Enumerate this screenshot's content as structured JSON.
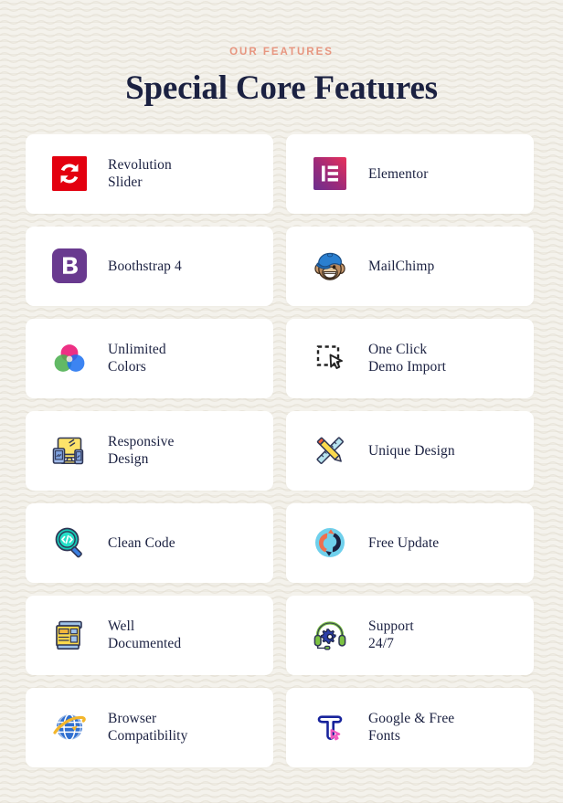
{
  "header": {
    "eyebrow": "OUR FEATURES",
    "headline": "Special Core Features",
    "eyebrow_color": "#e79680",
    "headline_color": "#1b2141"
  },
  "theme": {
    "page_background": "#f4f2ec",
    "card_background": "#ffffff",
    "text_color": "#1b2141"
  },
  "features": [
    {
      "title": "Revolution\nSlider",
      "icon": "revolution-slider-icon"
    },
    {
      "title": "Elementor",
      "icon": "elementor-icon"
    },
    {
      "title": "Boothstrap 4",
      "icon": "bootstrap-icon"
    },
    {
      "title": "MailChimp",
      "icon": "mailchimp-icon"
    },
    {
      "title": "Unlimited\nColors",
      "icon": "color-circles-icon"
    },
    {
      "title": "One Click\nDemo Import",
      "icon": "click-select-icon"
    },
    {
      "title": "Responsive\nDesign",
      "icon": "responsive-devices-icon"
    },
    {
      "title": "Unique Design",
      "icon": "pencil-ruler-icon"
    },
    {
      "title": "Clean Code",
      "icon": "code-magnifier-icon"
    },
    {
      "title": "Free Update",
      "icon": "refresh-circle-icon"
    },
    {
      "title": "Well\nDocumented",
      "icon": "documents-icon"
    },
    {
      "title": "Support\n24/7",
      "icon": "headset-gear-icon"
    },
    {
      "title": "Browser\nCompatibility",
      "icon": "globe-orbit-icon"
    },
    {
      "title": "Google & Free\nFonts",
      "icon": "font-t-cursor-icon"
    }
  ]
}
